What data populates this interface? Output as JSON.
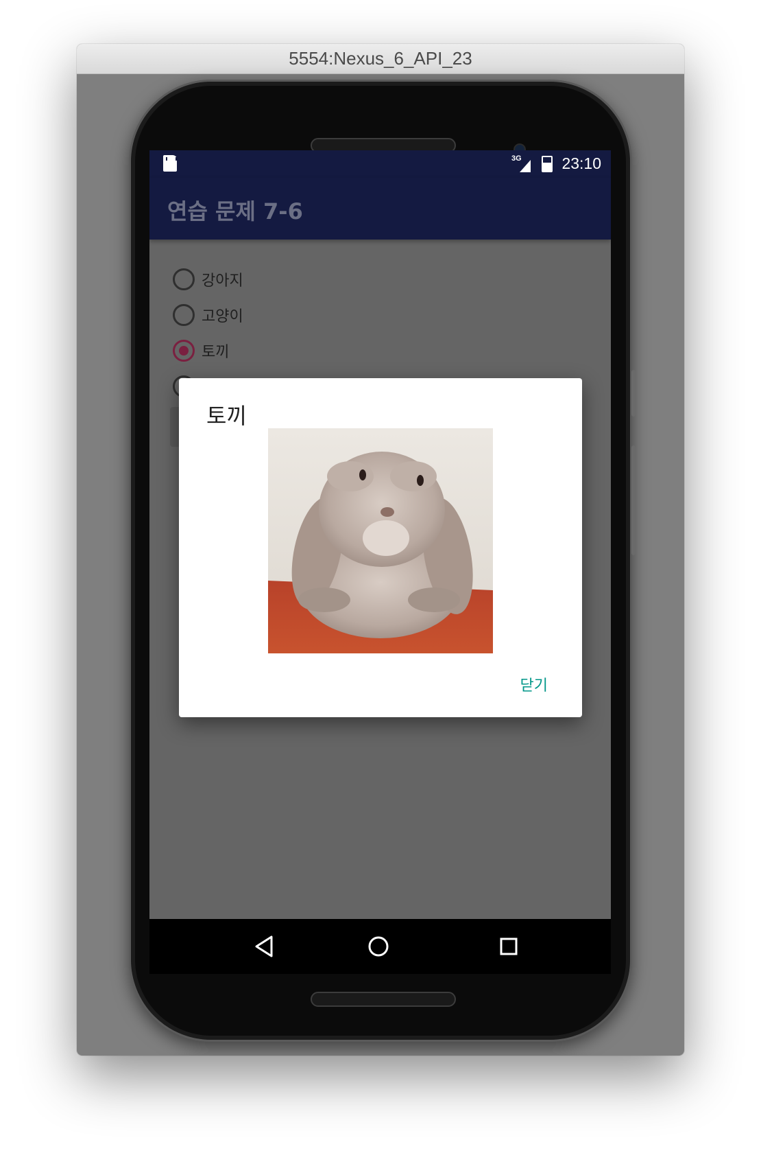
{
  "window": {
    "title": "5554:Nexus_6_API_23"
  },
  "statusbar": {
    "network_label": "3G",
    "time": "23:10"
  },
  "app": {
    "title": "연습 문제 7-6",
    "radio_options": [
      {
        "label": "강아지",
        "checked": false
      },
      {
        "label": "고양이",
        "checked": false
      },
      {
        "label": "토끼",
        "checked": true
      },
      {
        "label": "",
        "checked": false
      }
    ]
  },
  "dialog": {
    "title": "토끼",
    "image_icon": "rabbit-photo",
    "close_label": "닫기"
  },
  "navbar": {
    "back_icon": "back-icon",
    "home_icon": "home-icon",
    "recents_icon": "recents-icon"
  },
  "colors": {
    "primary_dark": "#141a41",
    "accent": "#7a2040",
    "dialog_button": "#009688"
  }
}
